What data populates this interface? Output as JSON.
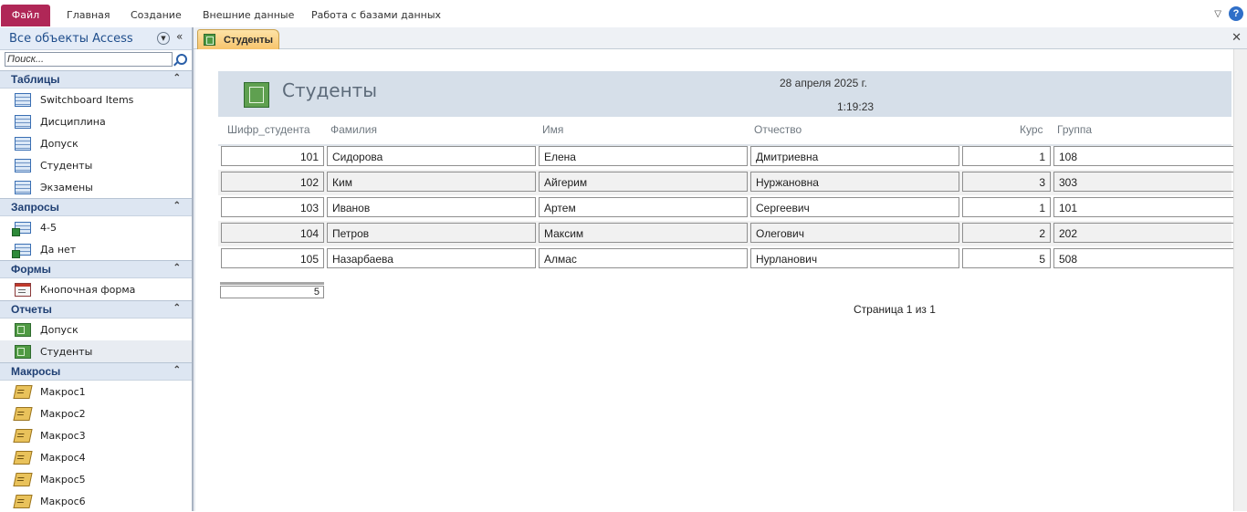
{
  "ribbon": {
    "file_tab": "Файл",
    "tabs": [
      "Главная",
      "Создание",
      "Внешние данные",
      "Работа с базами данных"
    ],
    "help_icon": "?"
  },
  "nav": {
    "title": "Все объекты Access",
    "search_placeholder": "Поиск...",
    "groups": [
      {
        "label": "Таблицы",
        "items": [
          "Switchboard Items",
          "Дисциплина",
          "Допуск",
          "Студенты",
          "Экзамены"
        ]
      },
      {
        "label": "Запросы",
        "items": [
          "4-5",
          "Да нет"
        ]
      },
      {
        "label": "Формы",
        "items": [
          "Кнопочная форма"
        ]
      },
      {
        "label": "Отчеты",
        "items": [
          "Допуск",
          "Студенты"
        ]
      },
      {
        "label": "Макросы",
        "items": [
          "Макрос1",
          "Макрос2",
          "Макрос3",
          "Макрос4",
          "Макрос5",
          "Макрос6"
        ]
      }
    ]
  },
  "doc_tab": {
    "label": "Студенты"
  },
  "report": {
    "title": "Студенты",
    "date": "28 апреля 2025 г.",
    "time": "1:19:23",
    "columns": [
      "Шифр_студента",
      "Фамилия",
      "Имя",
      "Отчество",
      "Курс",
      "Группа"
    ],
    "rows": [
      [
        "101",
        "Сидорова",
        "Елена",
        "Дмитриевна",
        "1",
        "108"
      ],
      [
        "102",
        "Ким",
        "Айгерим",
        "Нуржановна",
        "3",
        "303"
      ],
      [
        "103",
        "Иванов",
        "Артем",
        "Сергеевич",
        "1",
        "101"
      ],
      [
        "104",
        "Петров",
        "Максим",
        "Олегович",
        "2",
        "202"
      ],
      [
        "105",
        "Назарбаева",
        "Алмас",
        "Нурланович",
        "5",
        "508"
      ]
    ],
    "count": "5",
    "page_label": "Страница 1 из 1"
  }
}
